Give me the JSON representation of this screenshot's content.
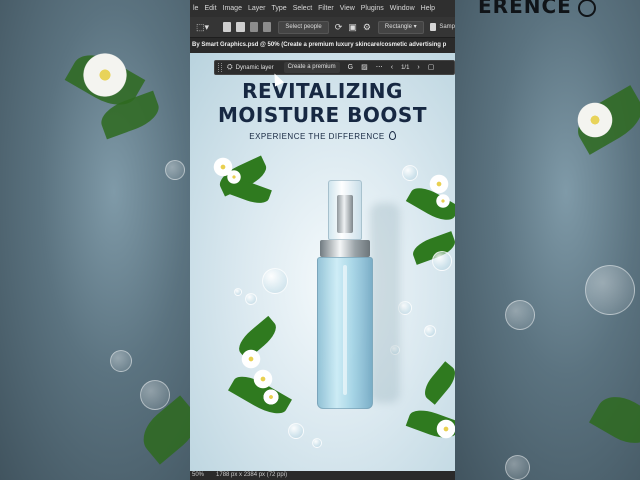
{
  "menu": [
    "le",
    "Edit",
    "Image",
    "Layer",
    "Type",
    "Select",
    "Filter",
    "View",
    "Plugins",
    "Window",
    "Help"
  ],
  "options": {
    "select_people": "Select people",
    "shape": "Rectangle",
    "sample": "Samp"
  },
  "document_tab": "By Smart Graphics.psd @ 50% (Create a premium luxury skincare/cosmetic advertising p",
  "context_bar": {
    "dynamic_layer": "Dynamic layer",
    "prompt": "Create a premium",
    "page": "1/1"
  },
  "ad": {
    "headline_1": "REVITALIZING",
    "headline_2": "MOISTURE BOOST",
    "subhead": "EXPERIENCE THE DIFFERENCE"
  },
  "status": {
    "zoom": "50%",
    "doc_info": "1788 px x 2384 px (72 ppi)"
  },
  "background_logo": "ERENCE",
  "colors": {
    "headline": "#172842",
    "leaf": "#2f7a1f",
    "app_dark": "#2b2b2b"
  }
}
